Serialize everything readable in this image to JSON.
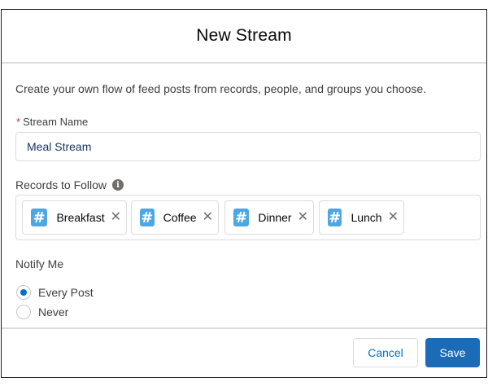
{
  "modal": {
    "title": "New Stream",
    "intro": "Create your own flow of feed posts from records, people, and groups you choose."
  },
  "stream_name": {
    "required_mark": "*",
    "label": "Stream Name",
    "value": "Meal Stream"
  },
  "records": {
    "label": "Records to Follow",
    "info_icon": "i",
    "hash_icon": "#",
    "close_icon": "✕",
    "pills": [
      {
        "label": "Breakfast"
      },
      {
        "label": "Coffee"
      },
      {
        "label": "Dinner"
      },
      {
        "label": "Lunch"
      }
    ]
  },
  "notify": {
    "label": "Notify Me",
    "options": [
      {
        "label": "Every Post",
        "selected": true
      },
      {
        "label": "Never",
        "selected": false
      }
    ]
  },
  "footer": {
    "cancel_label": "Cancel",
    "save_label": "Save"
  },
  "colors": {
    "brand": "#1b6bb7",
    "link": "#0070d2",
    "hashtag": "#4ea6e3",
    "required": "#c23934"
  }
}
